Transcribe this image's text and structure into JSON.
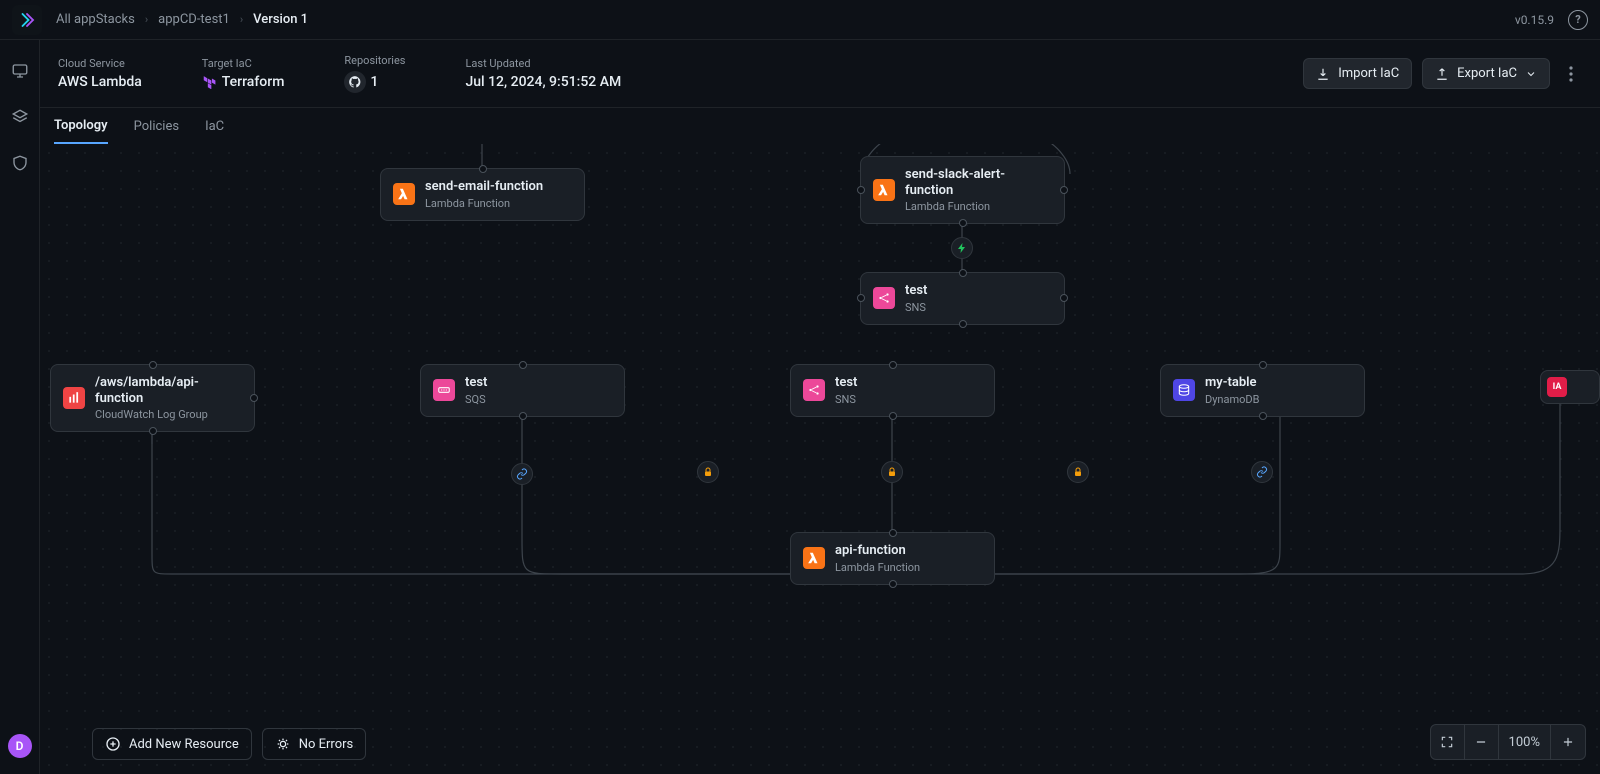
{
  "breadcrumbs": {
    "root": "All appStacks",
    "project": "appCD-test1",
    "version": "Version 1"
  },
  "app_version": "v0.15.9",
  "header": {
    "cloud_label": "Cloud Service",
    "cloud_value": "AWS Lambda",
    "iac_label": "Target IaC",
    "iac_value": "Terraform",
    "repo_label": "Repositories",
    "repo_count": "1",
    "updated_label": "Last Updated",
    "updated_value": "Jul 12, 2024, 9:51:52 AM",
    "import_btn": "Import IaC",
    "export_btn": "Export IaC"
  },
  "tabs": {
    "t0": "Topology",
    "t1": "Policies",
    "t2": "IaC"
  },
  "toolbar": {
    "add": "Add New Resource",
    "errors": "No Errors",
    "zoom": "100%"
  },
  "avatar": "D",
  "nodes": {
    "n_email": {
      "title": "send-email-function",
      "sub": "Lambda Function"
    },
    "n_slack": {
      "title": "send-slack-alert-function",
      "sub": "Lambda Function"
    },
    "n_sns1": {
      "title": "test",
      "sub": "SNS"
    },
    "n_cwl": {
      "title": "/aws/lambda/api-function",
      "sub": "CloudWatch Log Group"
    },
    "n_sqs": {
      "title": "test",
      "sub": "SQS"
    },
    "n_sns2": {
      "title": "test",
      "sub": "SNS"
    },
    "n_ddb": {
      "title": "my-table",
      "sub": "DynamoDB"
    },
    "n_iam": {
      "title": "IA",
      "sub": ""
    },
    "n_api": {
      "title": "api-function",
      "sub": "Lambda Function"
    }
  }
}
